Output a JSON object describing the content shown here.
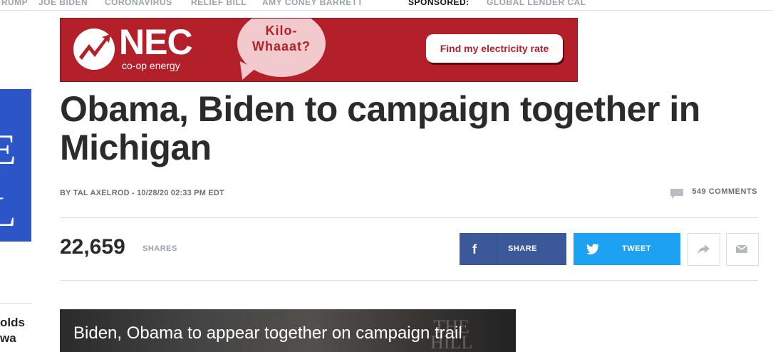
{
  "nav": {
    "items": [
      "TRUMP",
      "JOE BIDEN",
      "CORONAVIRUS",
      "RELIEF BILL",
      "AMY CONEY BARRETT"
    ],
    "sponsored": "SPONSORED:",
    "sponsored_item": "GLOBAL LENDER CAL"
  },
  "ad": {
    "brand": "NEC",
    "tagline": "co-op energy",
    "bubble_line1": "Kilo-",
    "bubble_line2": "Whaaat?",
    "cta": "Find my electricity rate",
    "colors": {
      "background": "#b3202a",
      "bubble": "#f2c9cd"
    }
  },
  "article": {
    "headline": "Obama, Biden to campaign together in Michigan",
    "byline": "BY TAL AXELROD - 10/28/20 02:33 PM EDT",
    "comments": "549 COMMENTS"
  },
  "shares": {
    "count": "22,659",
    "label": "SHARES",
    "facebook_label": "SHARE",
    "twitter_label": "TWEET",
    "colors": {
      "facebook": "#3b5998",
      "twitter": "#1da1f2"
    }
  },
  "left_rail": {
    "logo_letters": [
      "E",
      "L"
    ],
    "story_lines": [
      "olds",
      "wa"
    ]
  },
  "video": {
    "title": "Biden, Obama to appear together on campaign trail",
    "watermark_line1": "THE",
    "watermark_line2": "HILL"
  },
  "icons": {
    "comment": "comment-icon",
    "facebook": "facebook-icon",
    "twitter": "twitter-icon",
    "forward": "share-arrow-icon",
    "email": "email-icon"
  }
}
